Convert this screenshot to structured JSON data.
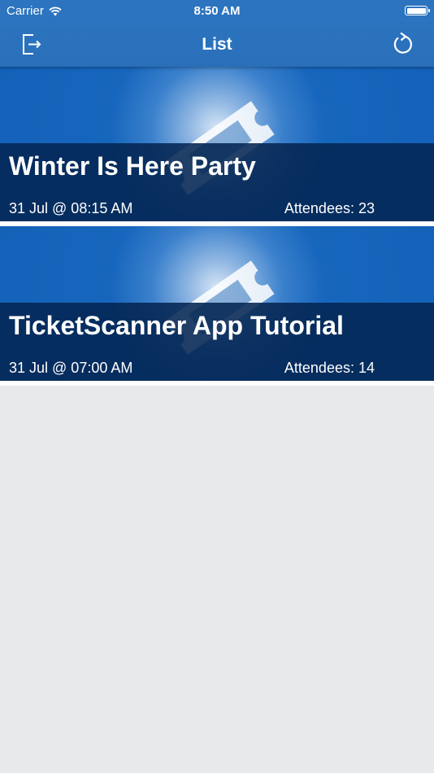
{
  "status_bar": {
    "carrier": "Carrier",
    "time": "8:50 AM"
  },
  "nav": {
    "title": "List",
    "left_icon": "logout-icon",
    "right_icon": "refresh-icon"
  },
  "events": [
    {
      "title": "Winter Is Here Party",
      "date": "31 Jul @ 08:15 AM",
      "attendees": "Attendees: 23"
    },
    {
      "title": "TicketScanner App Tutorial",
      "date": "31 Jul @ 07:00 AM",
      "attendees": "Attendees: 14"
    }
  ],
  "colors": {
    "nav_blue": "#2c74bf",
    "card_blue": "#1361b8",
    "overlay_navy": "#042652",
    "background": "#e8e9eb"
  }
}
